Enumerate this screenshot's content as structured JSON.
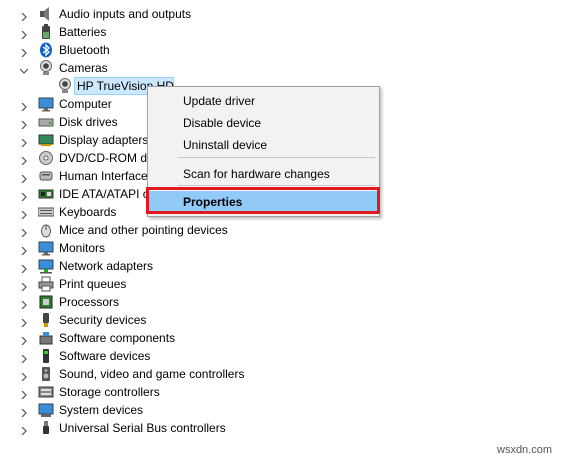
{
  "tree": {
    "items": [
      {
        "label": "Audio inputs and outputs",
        "icon": "speaker-icon",
        "expanded": false
      },
      {
        "label": "Batteries",
        "icon": "battery-icon",
        "expanded": false
      },
      {
        "label": "Bluetooth",
        "icon": "bluetooth-icon",
        "expanded": false
      },
      {
        "label": "Cameras",
        "icon": "webcam-icon",
        "expanded": true
      },
      {
        "label": "HP TrueVision HD",
        "icon": "webcam-icon",
        "child": true
      },
      {
        "label": "Computer",
        "icon": "monitor-icon",
        "expanded": false
      },
      {
        "label": "Disk drives",
        "icon": "disk-drive-icon",
        "expanded": false
      },
      {
        "label": "Display adapters",
        "icon": "display-adapter-icon",
        "expanded": false
      },
      {
        "label": "DVD/CD-ROM dr",
        "icon": "dvd-icon",
        "expanded": false
      },
      {
        "label": "Human Interface",
        "icon": "hid-icon",
        "expanded": false
      },
      {
        "label": "IDE ATA/ATAPI co",
        "icon": "ide-controller-icon",
        "expanded": false
      },
      {
        "label": "Keyboards",
        "icon": "keyboard-icon",
        "expanded": false
      },
      {
        "label": "Mice and other pointing devices",
        "icon": "mouse-icon",
        "expanded": false
      },
      {
        "label": "Monitors",
        "icon": "monitor-icon",
        "expanded": false
      },
      {
        "label": "Network adapters",
        "icon": "network-icon",
        "expanded": false
      },
      {
        "label": "Print queues",
        "icon": "printer-icon",
        "expanded": false
      },
      {
        "label": "Processors",
        "icon": "processor-icon",
        "expanded": false
      },
      {
        "label": "Security devices",
        "icon": "security-key-icon",
        "expanded": false
      },
      {
        "label": "Software components",
        "icon": "software-component-icon",
        "expanded": false
      },
      {
        "label": "Software devices",
        "icon": "software-device-icon",
        "expanded": false
      },
      {
        "label": "Sound, video and game controllers",
        "icon": "sound-icon",
        "expanded": false
      },
      {
        "label": "Storage controllers",
        "icon": "storage-controller-icon",
        "expanded": false
      },
      {
        "label": "System devices",
        "icon": "system-devices-icon",
        "expanded": false
      },
      {
        "label": "Universal Serial Bus controllers",
        "icon": "usb-icon",
        "expanded": false
      }
    ]
  },
  "context_menu": {
    "items": [
      {
        "label": "Update driver"
      },
      {
        "label": "Disable device"
      },
      {
        "label": "Uninstall device"
      },
      {
        "label": "Scan for hardware changes"
      },
      {
        "label": "Properties",
        "highlighted": true
      }
    ]
  },
  "colors": {
    "selection": "#cce8ff",
    "menu_highlight": "#91c9f7",
    "annotation_box": "#e0191f"
  },
  "watermark": "wsxdn.com"
}
